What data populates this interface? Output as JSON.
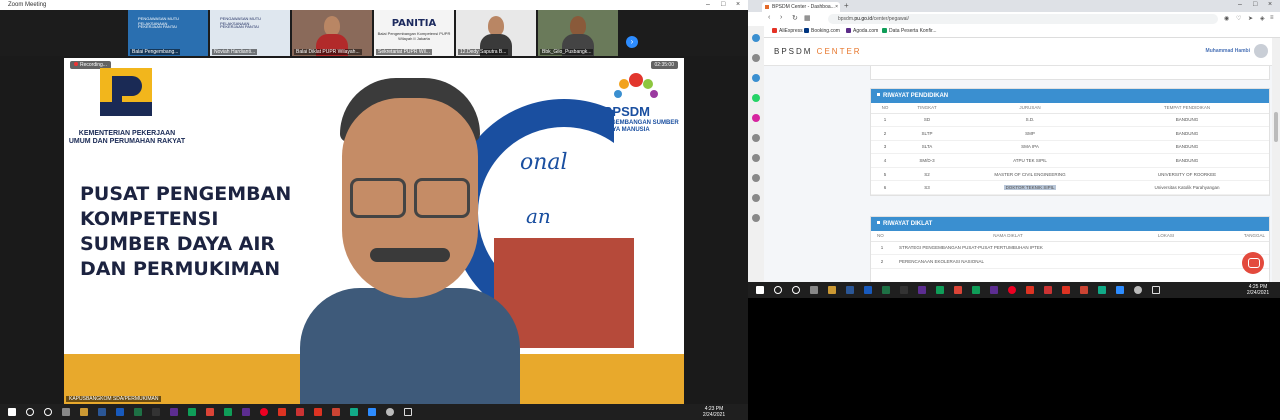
{
  "zoom": {
    "window_title": "Zoom Meeting",
    "thumbnails": [
      {
        "name": "Balai Pengembang...",
        "line1": "PENGAWASAN MUTU PELAKSANAAN",
        "line2": "PEKERJAAN PANTAI"
      },
      {
        "name": "Noviah Hardianti...",
        "line1": "PENGAWASAN MUTU PELAKSANAAN",
        "line2": "PEKERJAAN PANTAI"
      },
      {
        "name": "Balai Diklat PUPR Wilayah...",
        "line1": "",
        "line2": ""
      },
      {
        "name": "Sekretariat PUPR Wil...",
        "line1": "PANITIA",
        "line2": "Balai Pengembangan Kompetensi PUPR Wilayah II Jakarta"
      },
      {
        "name": "12.Dedy Saputra B...",
        "line1": "",
        "line2": ""
      },
      {
        "name": "Bbk_Gilo_Pusbangk...",
        "line1": "",
        "line2": ""
      }
    ],
    "recording_label": "Recording...",
    "elapsed": "02:35:00",
    "ministry": "KEMENTERIAN PEKERJAAN UMUM DAN PERUMAHAN RAKYAT",
    "bpsdm_word": "BPSDM",
    "bpsdm_sub": "BADAN PENGEMBANGAN SUMBER DAYA MANUSIA",
    "headline": [
      "PUSAT PENGEMBAN",
      "KOMPETENSI",
      "SUMBER DAYA AIR",
      "DAN PERMUKIMAN"
    ],
    "banner_script": [
      "onal",
      "an"
    ],
    "speaker": "KAPUSBANGKOM SDA/PERMUKIMAN"
  },
  "taskbar_left": {
    "time": "4:23 PM",
    "date": "2/24/2021"
  },
  "taskbar_right": {
    "time": "4:25 PM",
    "date": "2/24/2021"
  },
  "browser": {
    "tab_title": "BPSDM Center - Dashboa...",
    "url_prefix": "bpsdm.",
    "url_domain": "pu.go.id",
    "url_path": "/center/pegawai/",
    "bookmarks": [
      {
        "label": "AliExpress",
        "color": "#e43225"
      },
      {
        "label": "Booking.com",
        "color": "#003580"
      },
      {
        "label": "Agoda.com",
        "color": "#5b2c88"
      },
      {
        "label": "Data Peserta Konfir...",
        "color": "#0f9d58"
      }
    ],
    "site_logo_a": "BPSDM ",
    "site_logo_b": "CENTER",
    "user_name": "Muhammad Hambi",
    "pendidikan": {
      "title": "RIWAYAT PENDIDIKAN",
      "headers": [
        "NO",
        "TINGKAT",
        "JURUSAN",
        "TEMPAT PENDIDIKAN"
      ],
      "rows": [
        [
          "1",
          "SD",
          "S.D.",
          "BANDUNG"
        ],
        [
          "2",
          "SLTP",
          "SMP",
          "BANDUNG"
        ],
        [
          "3",
          "SLTA",
          "SMA IPA",
          "BANDUNG"
        ],
        [
          "4",
          "SM/D-3",
          "ATPU TEK SIPIL",
          "BANDUNG"
        ],
        [
          "5",
          "S2",
          "MASTER OF CIVIL ENGINEERING",
          "UNIVERSITY OF ROORKEE"
        ],
        [
          "6",
          "S3",
          "DOKTOR TEKNIK SIPIL",
          "Universitas Katolik Parahyangan"
        ]
      ]
    },
    "diklat": {
      "title": "RIWAYAT DIKLAT",
      "headers": [
        "NO",
        "NAMA DIKLAT",
        "LOKASI",
        "TANGGAL"
      ],
      "rows": [
        [
          "1",
          "STRATEGI PENGEMBANGAN PUSAT-PUSAT PERTUMBUHAN IPTEK",
          "",
          ""
        ],
        [
          "2",
          "PERENCANAAN EKOLERASI NASIONAL",
          "",
          ""
        ]
      ]
    }
  }
}
